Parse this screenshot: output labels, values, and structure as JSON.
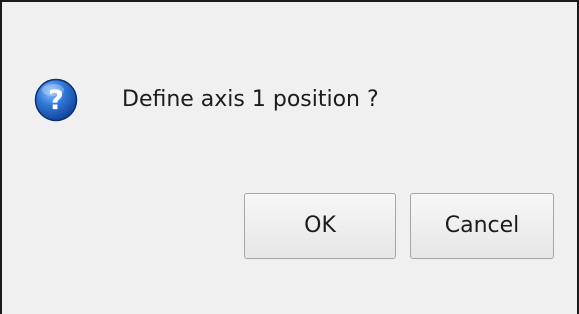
{
  "dialog": {
    "message": "Define axis 1 position ?",
    "icon": "question-icon",
    "ok_label": "OK",
    "cancel_label": "Cancel"
  },
  "colors": {
    "background": "#f0f0f0",
    "icon_blue": "#1e5bb8",
    "border": "#1a1a1a"
  }
}
